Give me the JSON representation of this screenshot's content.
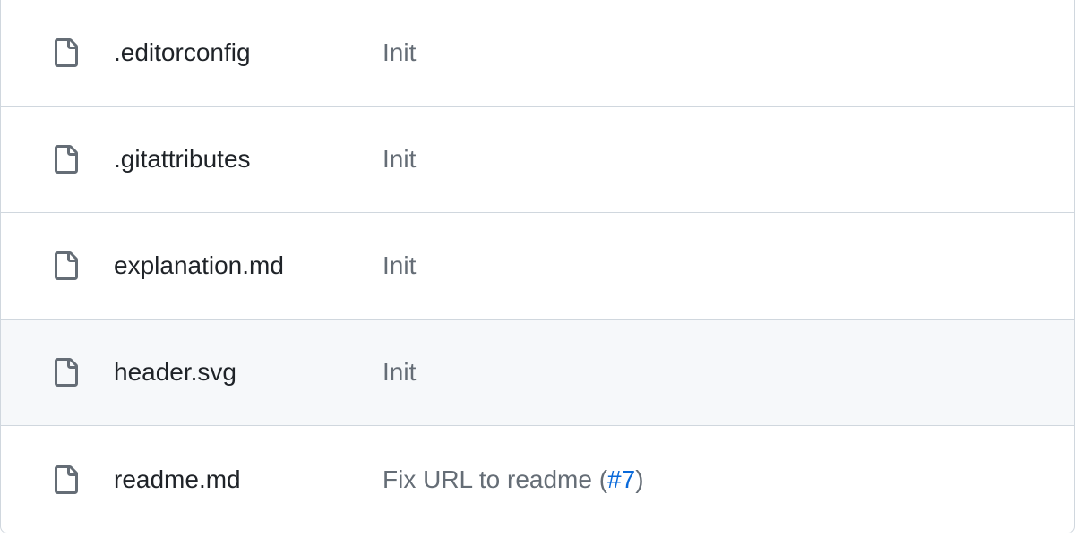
{
  "files": [
    {
      "name": ".editorconfig",
      "commit_message": "Init",
      "pr": null,
      "highlighted": false
    },
    {
      "name": ".gitattributes",
      "commit_message": "Init",
      "pr": null,
      "highlighted": false
    },
    {
      "name": "explanation.md",
      "commit_message": "Init",
      "pr": null,
      "highlighted": false
    },
    {
      "name": "header.svg",
      "commit_message": "Init",
      "pr": null,
      "highlighted": true
    },
    {
      "name": "readme.md",
      "commit_message": "Fix URL to readme ",
      "pr": "#7",
      "highlighted": false
    }
  ]
}
